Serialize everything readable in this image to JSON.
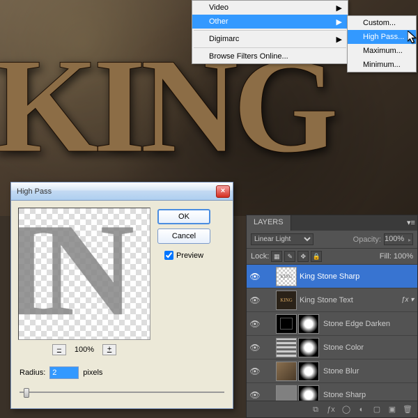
{
  "canvas_text": "KING",
  "menu": {
    "video": "Video",
    "other": "Other",
    "digimarc": "Digimarc",
    "browse": "Browse Filters Online..."
  },
  "submenu": {
    "custom": "Custom...",
    "highpass": "High Pass...",
    "maximum": "Maximum...",
    "minimum": "Minimum..."
  },
  "dialog": {
    "title": "High Pass",
    "ok": "OK",
    "cancel": "Cancel",
    "preview": "Preview",
    "zoom": "100%",
    "radius_label": "Radius:",
    "radius_value": "2",
    "radius_unit": "pixels",
    "preview_letters": "IN"
  },
  "layers_panel": {
    "title": "LAYERS",
    "blend": "Linear Light",
    "opacity_label": "Opacity:",
    "opacity": "100%",
    "lock_label": "Lock:",
    "fill_label": "Fill:",
    "fill": "100%",
    "layers": [
      {
        "name": "King Stone Sharp",
        "sel": true,
        "thumb": "king-s",
        "mask": false,
        "fx": false
      },
      {
        "name": "King Stone Text",
        "thumb": "king-t",
        "mask": false,
        "fx": true
      },
      {
        "name": "Stone Edge Darken",
        "thumb": "black",
        "mask": true,
        "fx": false
      },
      {
        "name": "Stone Color",
        "thumb": "stripes",
        "mask": true,
        "fx": false
      },
      {
        "name": "Stone Blur",
        "thumb": "stone",
        "mask": true,
        "fx": false
      },
      {
        "name": "Stone Sharp",
        "thumb": "gray",
        "mask": true,
        "fx": false
      }
    ]
  }
}
